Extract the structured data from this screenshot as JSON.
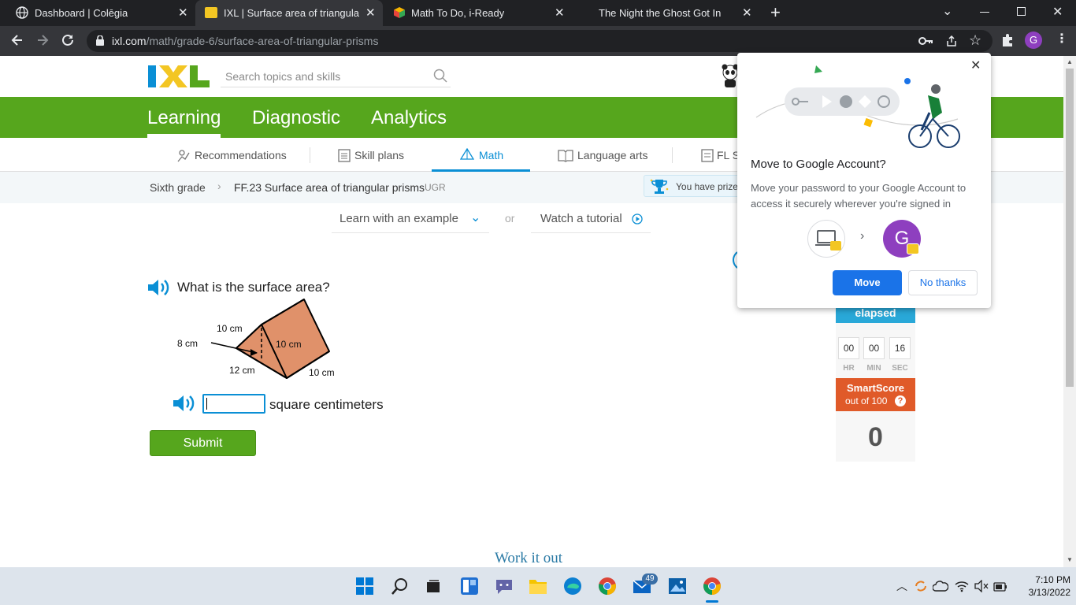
{
  "browser": {
    "tabs": [
      {
        "title": "Dashboard | Colēgia",
        "active": false
      },
      {
        "title": "IXL | Surface area of triangular pr",
        "active": true
      },
      {
        "title": "Math To Do, i-Ready",
        "active": false
      },
      {
        "title": "The Night the Ghost Got In",
        "active": false
      }
    ],
    "url_host": "ixl.com",
    "url_path": "/math/grade-6/surface-area-of-triangular-prisms",
    "profile_initial": "G"
  },
  "ixl": {
    "logo": "IXL",
    "search_placeholder": "Search topics and skills",
    "main_nav": [
      "Learning",
      "Diagnostic",
      "Analytics"
    ],
    "sub_nav": [
      "Recommendations",
      "Skill plans",
      "Math",
      "Language arts",
      "FL S"
    ],
    "breadcrumb": {
      "grade": "Sixth grade",
      "skill": "FF.23 Surface area of triangular prisms",
      "code": "UGR"
    },
    "prize_text": "You have prize",
    "learn_example": "Learn with an example",
    "or": "or",
    "watch_tutorial": "Watch a tutorial",
    "question": "What is the surface area?",
    "diagram_labels": {
      "top_edge": "10 cm",
      "left_height": "8 cm",
      "base": "12 cm",
      "face_slant": "10 cm",
      "length": "10 cm"
    },
    "answer_unit": "square centimeters",
    "submit": "Submit",
    "work_it_out": "Work it out",
    "sidebar": {
      "elapsed": "elapsed",
      "timer": {
        "hr": "00",
        "min": "00",
        "sec": "16"
      },
      "timer_labels": {
        "hr": "HR",
        "min": "MIN",
        "sec": "SEC"
      },
      "smartscore_title": "SmartScore",
      "smartscore_sub": "out of 100",
      "score": "0"
    }
  },
  "popup": {
    "title": "Move to Google Account?",
    "body": "Move your password to your Google Account to access it securely wherever you're signed in",
    "avatar_initial": "G",
    "move": "Move",
    "no_thanks": "No thanks"
  },
  "taskbar": {
    "mail_badge": "49",
    "time": "7:10 PM",
    "date": "3/13/2022"
  },
  "colors": {
    "ixl_green": "#56a61d",
    "ixl_blue": "#0a8fd5",
    "smartscore_orange": "#e05a29",
    "prism_fill": "#e0916a",
    "google_blue": "#1a73e8"
  }
}
